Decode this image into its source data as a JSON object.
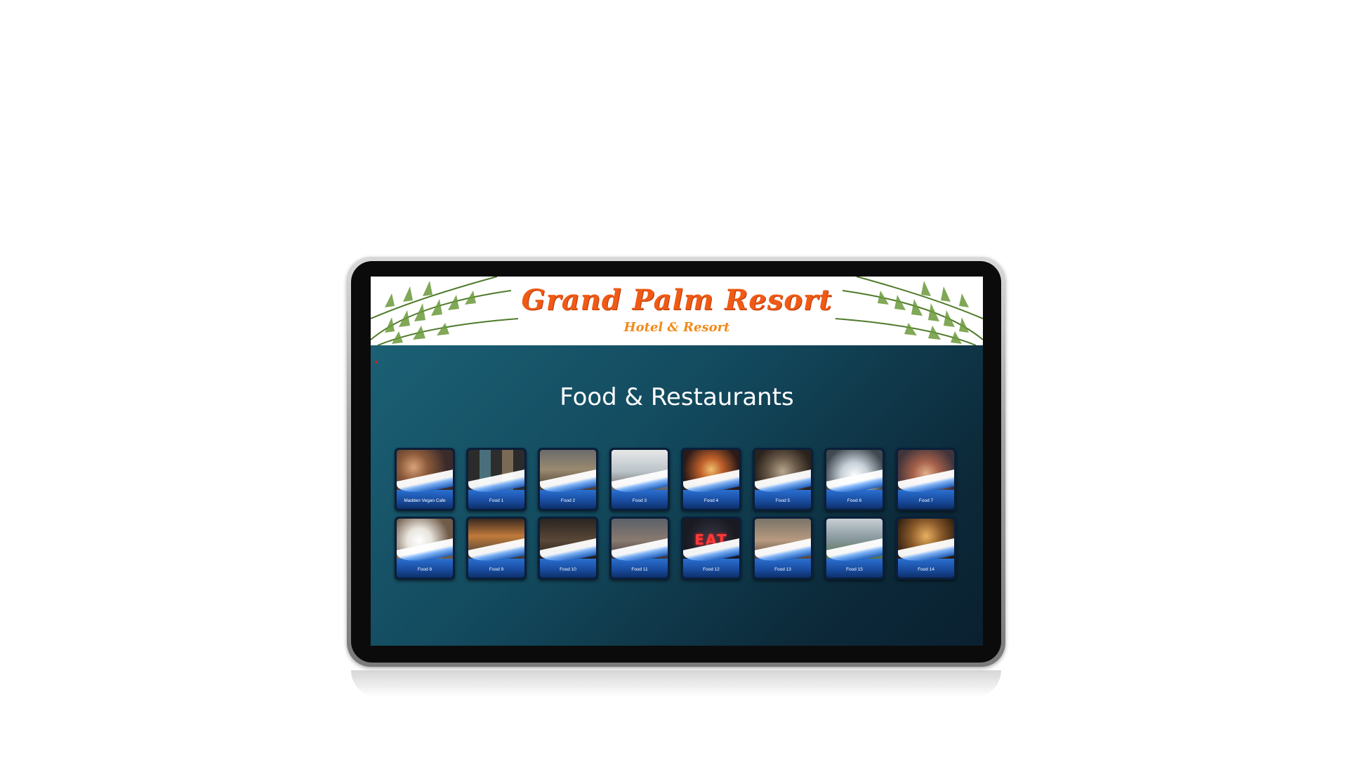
{
  "banner": {
    "title": "Grand Palm Resort",
    "subtitle": "Hotel & Resort"
  },
  "page": {
    "title": "Food & Restaurants"
  },
  "tiles": [
    {
      "label": "Madden Vegan Cafe",
      "icon": "restaurant-photo"
    },
    {
      "label": "Food 1",
      "icon": "restaurant-photo"
    },
    {
      "label": "Food 2",
      "icon": "restaurant-photo"
    },
    {
      "label": "Food 3",
      "icon": "restaurant-photo"
    },
    {
      "label": "Food 4",
      "icon": "restaurant-photo"
    },
    {
      "label": "Food 5",
      "icon": "restaurant-photo"
    },
    {
      "label": "Food 6",
      "icon": "restaurant-photo"
    },
    {
      "label": "Food 7",
      "icon": "restaurant-photo"
    },
    {
      "label": "Food 8",
      "icon": "restaurant-photo"
    },
    {
      "label": "Food 9",
      "icon": "restaurant-photo"
    },
    {
      "label": "Food 10",
      "icon": "restaurant-photo"
    },
    {
      "label": "Food 11",
      "icon": "restaurant-photo"
    },
    {
      "label": "Food 12",
      "icon": "restaurant-photo",
      "sign_text": "EAT"
    },
    {
      "label": "Food 13",
      "icon": "restaurant-photo"
    },
    {
      "label": "Food 15",
      "icon": "restaurant-photo"
    },
    {
      "label": "Food 14",
      "icon": "restaurant-photo"
    }
  ],
  "colors": {
    "title_orange": "#f05a14",
    "background_teal": "#134a5e",
    "tile_blue": "#2a6fd0"
  }
}
